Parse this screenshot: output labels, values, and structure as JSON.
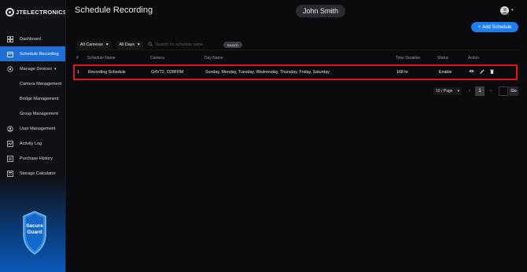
{
  "brand": {
    "logo_text": "JTELECTRONICS"
  },
  "sidebar": {
    "items": [
      {
        "label": "Dashboard",
        "icon": "dashboard-icon"
      },
      {
        "label": "Schedule Recording",
        "icon": "calendar-icon",
        "active": true
      },
      {
        "label": "Manage Devices",
        "icon": "devices-icon",
        "expanded": true
      },
      {
        "label": "Camera Management",
        "sub": true
      },
      {
        "label": "Bridge Management",
        "sub": true
      },
      {
        "label": "Group Management",
        "sub": true
      },
      {
        "label": "User Management",
        "icon": "user-icon"
      },
      {
        "label": "Activity Log",
        "icon": "activity-icon"
      },
      {
        "label": "Purchase History",
        "icon": "history-icon"
      },
      {
        "label": "Storage Calculator",
        "icon": "calculator-icon"
      }
    ],
    "badge": {
      "line1": "Secure",
      "line2": "Guard"
    }
  },
  "header": {
    "title": "Schedule Recording",
    "user_name": "John Smith",
    "add_button": "Add Schedule"
  },
  "filters": {
    "cameras": "All Cameras",
    "days": "All Days",
    "search_placeholder": "Search for schedule name",
    "search_button": "Search"
  },
  "table": {
    "columns": [
      "#",
      "Schedule Name",
      "Camera",
      "Day Name",
      "Time Duration",
      "Status",
      "Action"
    ],
    "rows": [
      {
        "index": "1",
        "name": "Recording Schedule",
        "camera": "G4VT2, O28FRM",
        "days": "Sunday, Monday, Tuesday, Wednesday, Thursday, Friday, Saturday",
        "duration": "168 hr",
        "status": "Enable"
      }
    ]
  },
  "pagination": {
    "page_size": "10 / Page",
    "current_page": "1",
    "go_label": "Go",
    "prev": "‹",
    "next": "›"
  },
  "colors": {
    "accent": "#1e7ef0",
    "active_nav": "#1f6fd6",
    "highlight": "#d91820",
    "background": "#0b0b0d"
  }
}
